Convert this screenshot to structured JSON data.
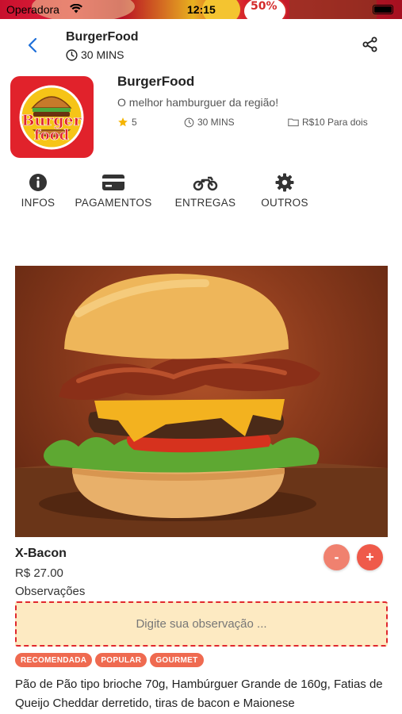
{
  "status_bar": {
    "carrier": "Operadora",
    "time": "12:15",
    "banner_text": "50%"
  },
  "header": {
    "title": "BurgerFood",
    "delivery_time": "30 MINS",
    "icons": {
      "back": "chevron-left-icon",
      "clock": "clock-icon",
      "share": "share-icon"
    }
  },
  "restaurant": {
    "name": "BurgerFood",
    "description": "O melhor hamburguer da região!",
    "logo_line1": "Burger",
    "logo_line2": "food",
    "rating": "5",
    "time": "30 MINS",
    "price": "R$10 Para dois"
  },
  "tabs": [
    {
      "label": "INFOS",
      "icon": "info-icon"
    },
    {
      "label": "PAGAMENTOS",
      "icon": "credit-card-icon"
    },
    {
      "label": "ENTREGAS",
      "icon": "motorcycle-icon"
    },
    {
      "label": "OUTROS",
      "icon": "gear-icon"
    }
  ],
  "product": {
    "name": "X-Bacon",
    "price": "R$ 27.00",
    "observations_label": "Observações",
    "observation_placeholder": "Digite sua observação ...",
    "minus_label": "-",
    "plus_label": "+",
    "badges": [
      "RECOMENDADA",
      "POPULAR",
      "GOURMET"
    ],
    "description": " Pão de Pão tipo brioche 70g, Hambúrguer Grande de 160g, Fatias de Queijo Cheddar derretido, tiras de bacon e Maionese"
  },
  "colors": {
    "accent": "#ef5a4a",
    "accent_light": "#f0816f",
    "brand_red": "#e1222b",
    "input_bg": "#fdeac2",
    "star": "#f5b400",
    "back_arrow": "#1e6fd9"
  }
}
